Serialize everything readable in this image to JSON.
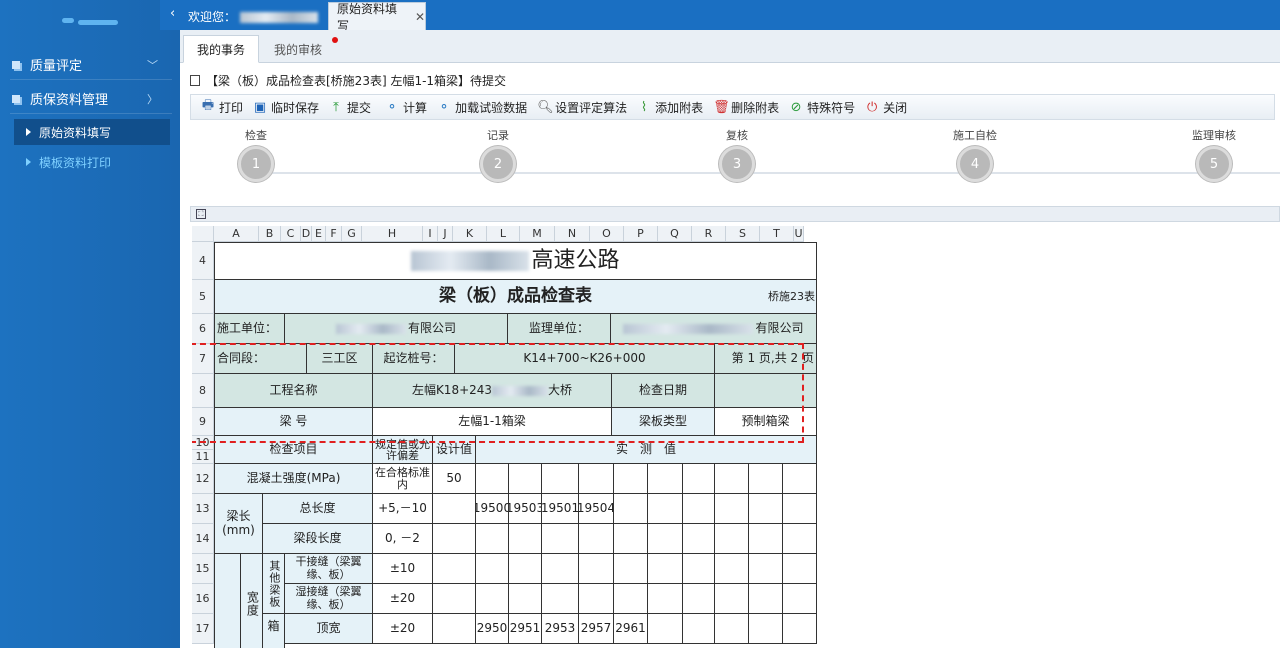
{
  "sidebar": {
    "items": [
      {
        "label": "质量评定"
      },
      {
        "label": "质保资料管理"
      }
    ],
    "subitems": [
      {
        "label": "原始资料填写"
      },
      {
        "label": "模板资料打印"
      }
    ],
    "colors": {
      "active_sub_text": "#ffffff",
      "inactive_sub_text": "#7fd0ff"
    }
  },
  "topbar": {
    "welcome": "欢迎您：",
    "tab": "原始资料填写"
  },
  "subtabs": [
    {
      "label": "我的事务"
    },
    {
      "label": "我的审核"
    }
  ],
  "doc_title": "【梁（板）成品检查表[桥施23表] 左幅1-1箱梁】待提交",
  "toolbar": [
    {
      "label": "打印",
      "icon": "print-icon"
    },
    {
      "label": "临时保存",
      "icon": "save-icon"
    },
    {
      "label": "提交",
      "icon": "submit-icon"
    },
    {
      "label": "计算",
      "icon": "calc-icon"
    },
    {
      "label": "加载试验数据",
      "icon": "load-data-icon"
    },
    {
      "label": "设置评定算法",
      "icon": "search-icon"
    },
    {
      "label": "添加附表",
      "icon": "attach-icon"
    },
    {
      "label": "删除附表",
      "icon": "delete-icon"
    },
    {
      "label": "特殊符号",
      "icon": "symbol-icon"
    },
    {
      "label": "关闭",
      "icon": "power-icon"
    }
  ],
  "steps": [
    {
      "label": "检查",
      "num": "1"
    },
    {
      "label": "记录",
      "num": "2"
    },
    {
      "label": "复核",
      "num": "3"
    },
    {
      "label": "施工自检",
      "num": "4"
    },
    {
      "label": "监理审核",
      "num": "5"
    }
  ],
  "columns": [
    "A",
    "B",
    "C",
    "D",
    "E",
    "F",
    "G",
    "H",
    "I",
    "J",
    "K",
    "L",
    "M",
    "N",
    "O",
    "P",
    "Q",
    "R",
    "S",
    "T",
    "U"
  ],
  "rows": [
    "4",
    "5",
    "6",
    "7",
    "8",
    "9",
    "10",
    "11",
    "12",
    "13",
    "14",
    "15",
    "16",
    "17"
  ],
  "sheet": {
    "title": "高速公路",
    "form_title": "梁（板）成品检查表",
    "form_code": "桥施23表",
    "r6": {
      "construction_label": "施工单位：",
      "construction_value": "有限公司",
      "supervision_label": "监理单位：",
      "supervision_value": "有限公司"
    },
    "r7": {
      "contract_label": "合同段：",
      "contract_value": "三工区",
      "station_label": "起讫桩号：",
      "station_value": "K14+700~K26+000",
      "page": "第 1 页,共 2 页"
    },
    "r8": {
      "project_label": "工程名称",
      "project_value_a": "左幅K18+243",
      "project_value_b": "大桥",
      "date_label": "检查日期"
    },
    "r9": {
      "beam_no_label": "梁 号",
      "beam_no_value": "左幅1-1箱梁",
      "type_label": "梁板类型",
      "type_value": "预制箱梁"
    },
    "r10": {
      "item_label": "检查项目",
      "spec_label": "规定值或允许偏差",
      "design_label": "设计值",
      "measured_label": "实　测　值"
    },
    "r12": {
      "item": "混凝土强度(MPa)",
      "spec": "在合格标准内",
      "design": "50"
    },
    "r13": {
      "group": "梁长(mm)",
      "item": "总长度",
      "spec": "+5,－10",
      "values": [
        "19500",
        "19503",
        "19501",
        "19504"
      ]
    },
    "r14": {
      "item": "梁段长度",
      "spec": "0, －2"
    },
    "r15": {
      "group_a": "宽度",
      "group_b": "其他梁板",
      "item": "干接缝（梁翼缘、板）",
      "spec": "±10"
    },
    "r16": {
      "item": "湿接缝（梁翼缘、板）",
      "spec": "±20"
    },
    "r17": {
      "group_c": "箱",
      "item": "顶宽",
      "spec": "±20",
      "values": [
        "2950",
        "2951",
        "2953",
        "2957",
        "2961"
      ]
    }
  }
}
